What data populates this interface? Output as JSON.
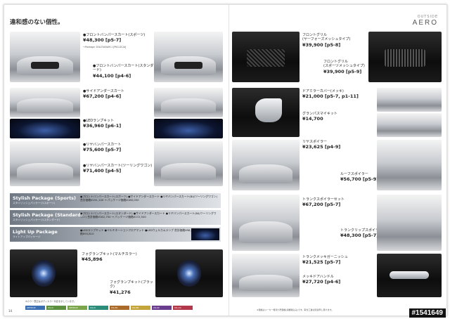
{
  "header": {
    "title": "違和感のない個性。",
    "section_kicker": "OUTSIDE",
    "section": "AERO"
  },
  "items": {
    "front_spoiler": {
      "name": "●フロントバンパースカート(スポーツ)",
      "price": "¥48,300 [p5-7]"
    },
    "front_spoiler_std": {
      "name": "●フロントバンパースカート(スタンダード)",
      "price": "¥44,100 [p4-6]"
    },
    "side": {
      "name": "●サイドアンダースカート",
      "price": "¥67,200 [p4-6]"
    },
    "led": {
      "name": "●LEDランプキット",
      "price": "¥36,960 [p6-1]"
    },
    "rear": {
      "name": "●リヤバンパースカート",
      "price": "¥75,600 [p5-7]"
    },
    "rear2": {
      "name": "●リヤバンパースカート(ツーリングワゴン)",
      "price": "¥71,400 [p4-5]"
    },
    "grille": {
      "name": "フロントグリル",
      "sub": "(ヤーフォーズメッシュタイプ)",
      "price": "¥39,900 [p5-8]"
    },
    "grille2": {
      "name": "フロントグリル",
      "sub": "(スポーツメッシュタイプ)",
      "price": "¥39,900 [p5-9]"
    },
    "mirror": {
      "name": "ドアミラーカバー(メッキ)",
      "price": "¥21,000 [p5-7, p1-11]"
    },
    "mirror2": {
      "name": "グランパスマイキット",
      "price": "¥14,700"
    },
    "roof": {
      "name": "ルーフスポイラー",
      "price": "¥56,700 [p5-9]"
    },
    "wing": {
      "name": "リヤスポイラー",
      "price": "¥23,625 [p4-9]"
    },
    "trunk": {
      "name": "トランクスポイラーセット",
      "price": "¥67,200 [p5-7]"
    },
    "trunk2": {
      "name": "トランクリップスポイラー",
      "price": "¥48,300 [p5-7]"
    },
    "trunk3": {
      "name": "トランクメッキガーニッシュ",
      "price": "¥21,525 [p5-7]"
    },
    "handle": {
      "name": "メッキドアハンドル",
      "price": "¥27,720 [p4-6]"
    },
    "fog": {
      "name": "フォグランプキット(マルチカラー)",
      "price": "¥45,896"
    },
    "fog2": {
      "name": "フォグランプキット(ブラック)",
      "price": "¥41,276"
    }
  },
  "packages": [
    {
      "name": "Stylish Package (Sports)",
      "sub": "スタイリッシュパッケージ(スポーツ)",
      "text": "●フロントバンパースカート(スポーツ) ●サイドアンダースカート ●リヤバンパースカート(B4/ツーリングワゴン) 合計価格¥191,100 → パッケージ価格¥180,050"
    },
    {
      "name": "Stylish Package (Standard)",
      "sub": "スタイリッシュパッケージ(スタンダード)",
      "text": "●フロントバンパースカート(スタンダード) ●サイドアンダースカート ●リヤバンパースカート(B4/ツーリングワゴン) 合計価格¥182,750 → パッケージ価格¥172,500"
    },
    {
      "name": "Light Up Package",
      "sub": "ライトアップパッケージ",
      "text": "●LEDランプキット ●イルミネーションフロアマット ●LEDウェルカムランプ 合計価格¥98,400 → パッケージ価格¥93,810"
    }
  ],
  "swatches": [
    {
      "label": "OBTROP",
      "color": "#3c6fb2"
    },
    {
      "label": "OS-N",
      "color": "#5c8f3e"
    },
    {
      "label": "OBTROP",
      "color": "#7ba54a"
    },
    {
      "label": "OS-N",
      "color": "#2d8d7a"
    },
    {
      "label": "OS-PD",
      "color": "#a96a2a"
    },
    {
      "label": "OS-PB",
      "color": "#c4a53c"
    },
    {
      "label": "OS-IN",
      "color": "#6b3d8f"
    },
    {
      "label": "OS-OC",
      "color": "#b2384a"
    }
  ],
  "footer": {
    "page_num": "14",
    "legend_note": "※カラー表記はボディカラー対応を示しています。",
    "disclaimer": "※価格はメーカー希望小売価格(消費税込み)です。取付工賃は別途申し受けます。",
    "badge": "#1541649"
  }
}
